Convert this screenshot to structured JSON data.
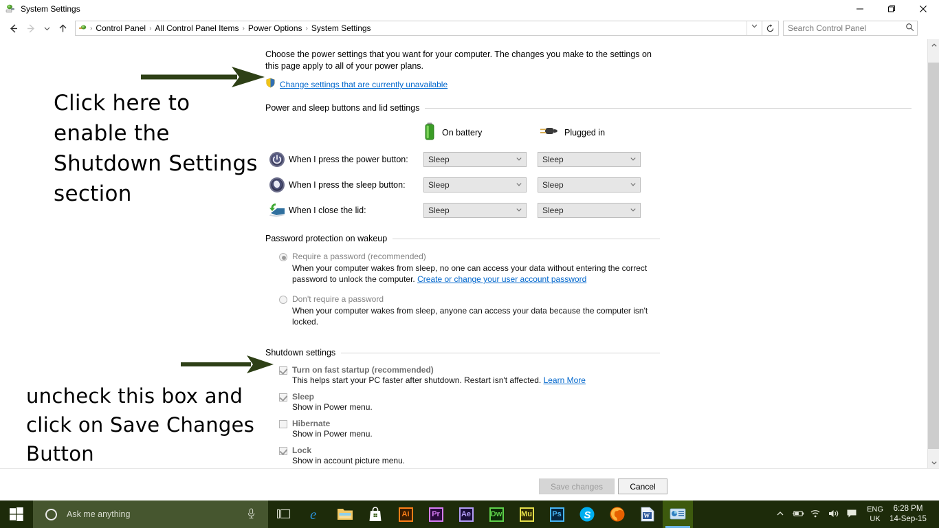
{
  "window": {
    "title": "System Settings",
    "minimize_label": "—",
    "maximize_label": "❐",
    "close_label": "✕"
  },
  "nav": {
    "back_label": "←",
    "forward_label": "→",
    "recent_label": "∨",
    "up_label": "↑",
    "refresh_label": "↻",
    "breadcrumbs": [
      "Control Panel",
      "All Control Panel Items",
      "Power Options",
      "System Settings"
    ],
    "separator": "›",
    "dropdown_label": "∨"
  },
  "search": {
    "placeholder": "Search Control Panel",
    "icon_label": "⌕"
  },
  "page": {
    "intro": "Choose the power settings that you want for your computer. The changes you make to the settings on this page apply to all of your power plans.",
    "admin_link": "Change settings that are currently unavailable"
  },
  "power_section": {
    "heading": "Power and sleep buttons and lid settings",
    "columns": [
      {
        "label": "On battery",
        "icon": "battery-icon"
      },
      {
        "label": "Plugged in",
        "icon": "power-plug-icon"
      }
    ],
    "rows": [
      {
        "icon": "power-button-icon",
        "label": "When I press the power button:",
        "on_battery": "Sleep",
        "plugged_in": "Sleep"
      },
      {
        "icon": "sleep-button-icon",
        "label": "When I press the sleep button:",
        "on_battery": "Sleep",
        "plugged_in": "Sleep"
      },
      {
        "icon": "laptop-lid-icon",
        "label": "When I close the lid:",
        "on_battery": "Sleep",
        "plugged_in": "Sleep"
      }
    ],
    "combo_chevron": "∨"
  },
  "password_section": {
    "heading": "Password protection on wakeup",
    "options": [
      {
        "label": "Require a password (recommended)",
        "selected": true,
        "description": "When your computer wakes from sleep, no one can access your data without entering the correct password to unlock the computer.",
        "link": "Create or change your user account password"
      },
      {
        "label": "Don't require a password",
        "selected": false,
        "description": "When your computer wakes from sleep, anyone can access your data because the computer isn't locked.",
        "link": ""
      }
    ]
  },
  "shutdown_section": {
    "heading": "Shutdown settings",
    "items": [
      {
        "label": "Turn on fast startup (recommended)",
        "checked": true,
        "description": "This helps start your PC faster after shutdown. Restart isn't affected.",
        "link": "Learn More"
      },
      {
        "label": "Sleep",
        "checked": true,
        "description": "Show in Power menu.",
        "link": ""
      },
      {
        "label": "Hibernate",
        "checked": false,
        "description": "Show in Power menu.",
        "link": ""
      },
      {
        "label": "Lock",
        "checked": true,
        "description": "Show in account picture menu.",
        "link": ""
      }
    ]
  },
  "footer": {
    "save_label": "Save changes",
    "cancel_label": "Cancel"
  },
  "annotations": [
    {
      "text": "Click here to enable the Shutdown Settings section",
      "arrow_color": "#2e4016"
    },
    {
      "text": "uncheck this box and click on Save Changes Button",
      "arrow_color": "#2e4016"
    }
  ],
  "taskbar": {
    "start_label": "start-button",
    "cortana_placeholder": "Ask me anything",
    "mic_label": "ᵚ",
    "task_view_label": "task-view",
    "apps": [
      {
        "name": "edge",
        "label": "e",
        "color": "#2b8fd4",
        "type": "glyph"
      },
      {
        "name": "file-explorer",
        "label": "",
        "color": "#f3c966",
        "type": "folder"
      },
      {
        "name": "microsoft-store",
        "label": "",
        "color": "#ffffff",
        "type": "store"
      },
      {
        "name": "illustrator",
        "label": "Ai",
        "color": "#ff7f18",
        "bg": "#3a1c00",
        "type": "adobe"
      },
      {
        "name": "premiere-pro",
        "label": "Pr",
        "color": "#d77cf5",
        "bg": "#2a0a3d",
        "type": "adobe"
      },
      {
        "name": "after-effects",
        "label": "Ae",
        "color": "#b39cf7",
        "bg": "#190d3a",
        "type": "adobe"
      },
      {
        "name": "dreamweaver",
        "label": "Dw",
        "color": "#5fd14a",
        "bg": "#0b2a06",
        "type": "adobe"
      },
      {
        "name": "muse",
        "label": "Mu",
        "color": "#e5e04a",
        "bg": "#2c2a05",
        "type": "adobe"
      },
      {
        "name": "photoshop",
        "label": "Ps",
        "color": "#47b6f5",
        "bg": "#04243d",
        "type": "adobe"
      },
      {
        "name": "skype",
        "label": "S",
        "color": "#00aff0",
        "type": "circle"
      },
      {
        "name": "firefox",
        "label": "",
        "color": "#e66000",
        "type": "firefox"
      },
      {
        "name": "word",
        "label": "W",
        "color": "#2b579a",
        "type": "word"
      },
      {
        "name": "system-settings",
        "label": "",
        "color": "#3f9fd4",
        "type": "active"
      }
    ],
    "tray": {
      "chevron": "∧",
      "battery": "ὐB",
      "network": "◠",
      "volume": "ὐA",
      "action_center": "὚3",
      "language_line1": "ENG",
      "language_line2": "UK",
      "time": "6:28 PM",
      "date": "14-Sep-15"
    }
  }
}
